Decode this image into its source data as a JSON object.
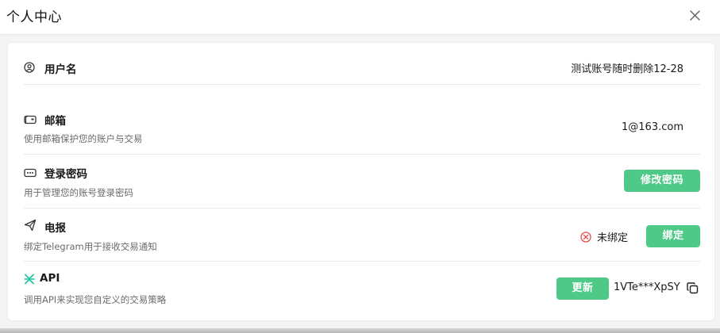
{
  "modal": {
    "title": "个人中心"
  },
  "rows": {
    "username": {
      "icon": "user-circle-icon",
      "title": "用户名",
      "value": "测试账号随时删除12-28"
    },
    "email": {
      "icon": "mailbox-icon",
      "title": "邮箱",
      "desc": "使用邮箱保护您的账户与交易",
      "value": "1@163.com"
    },
    "password": {
      "icon": "password-icon",
      "title": "登录密码",
      "desc": "用于管理您的账号登录密码",
      "button": "修改密码"
    },
    "telegram": {
      "icon": "paper-plane-icon",
      "title": "电报",
      "desc": "绑定Telegram用于接收交易通知",
      "status_icon": "x-circle-icon",
      "status": "未绑定",
      "button": "绑定"
    },
    "api": {
      "icon": "api-logo-icon",
      "title": "API",
      "desc": "调用API来实现您自定义的交易策略",
      "button": "更新",
      "key": "1VTe***XpSY",
      "copy_icon": "copy-icon"
    }
  },
  "colors": {
    "accent": "#4fc987",
    "error": "#e5484d",
    "api_logo": "#1fc7a0"
  }
}
